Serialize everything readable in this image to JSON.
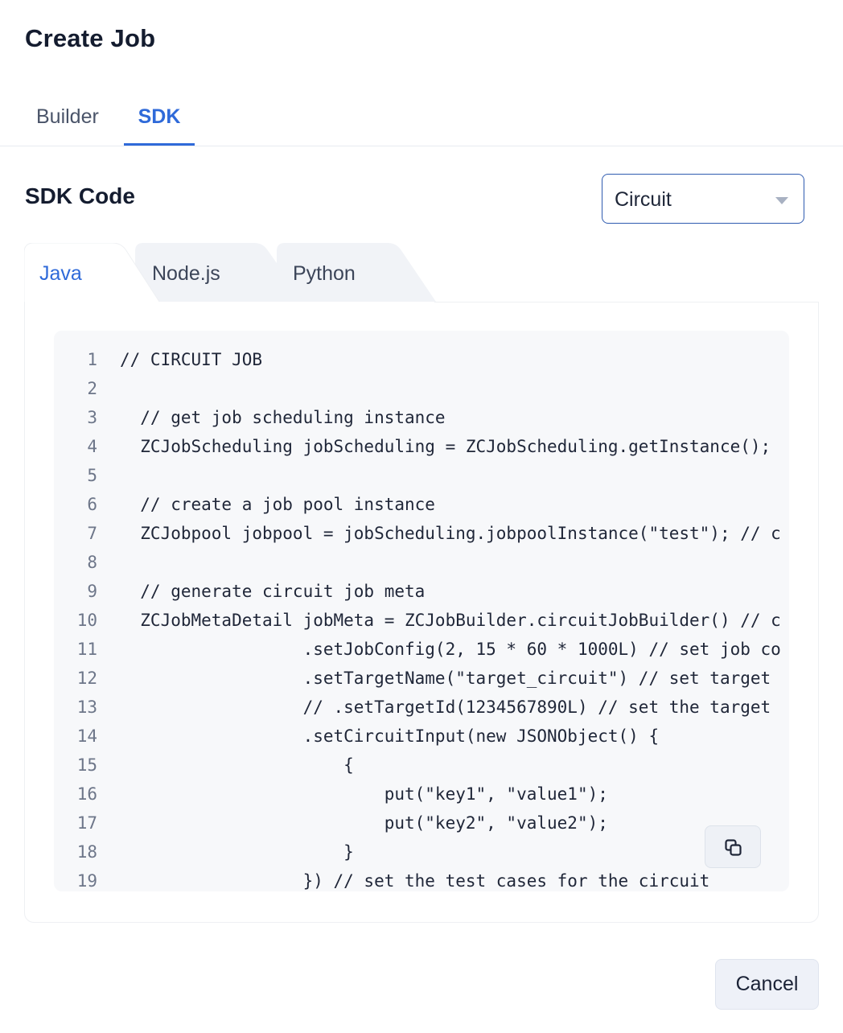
{
  "page": {
    "title": "Create Job"
  },
  "top_tabs": {
    "builder": "Builder",
    "sdk": "SDK"
  },
  "section": {
    "title": "SDK Code"
  },
  "job_type_select": {
    "value": "Circuit"
  },
  "lang_tabs": {
    "java": "Java",
    "node": "Node.js",
    "python": "Python"
  },
  "code": {
    "lines": [
      {
        "no": "1",
        "text": "// CIRCUIT JOB"
      },
      {
        "no": "2",
        "text": ""
      },
      {
        "no": "3",
        "text": "  // get job scheduling instance"
      },
      {
        "no": "4",
        "text": "  ZCJobScheduling jobScheduling = ZCJobScheduling.getInstance();"
      },
      {
        "no": "5",
        "text": ""
      },
      {
        "no": "6",
        "text": "  // create a job pool instance"
      },
      {
        "no": "7",
        "text": "  ZCJobpool jobpool = jobScheduling.jobpoolInstance(\"test\"); // c"
      },
      {
        "no": "8",
        "text": ""
      },
      {
        "no": "9",
        "text": "  // generate circuit job meta"
      },
      {
        "no": "10",
        "text": "  ZCJobMetaDetail jobMeta = ZCJobBuilder.circuitJobBuilder() // c"
      },
      {
        "no": "11",
        "text": "                  .setJobConfig(2, 15 * 60 * 1000L) // set job co"
      },
      {
        "no": "12",
        "text": "                  .setTargetName(\"target_circuit\") // set target"
      },
      {
        "no": "13",
        "text": "                  // .setTargetId(1234567890L) // set the target"
      },
      {
        "no": "14",
        "text": "                  .setCircuitInput(new JSONObject() {"
      },
      {
        "no": "15",
        "text": "                      {"
      },
      {
        "no": "16",
        "text": "                          put(\"key1\", \"value1\");"
      },
      {
        "no": "17",
        "text": "                          put(\"key2\", \"value2\");"
      },
      {
        "no": "18",
        "text": "                      }"
      },
      {
        "no": "19",
        "text": "                  }) // set the test cases for the circuit"
      }
    ]
  },
  "footer": {
    "cancel_label": "Cancel"
  },
  "icons": {
    "copy": "copy-icon",
    "caret": "caret-down-icon"
  },
  "colors": {
    "accent": "#2f6ad9",
    "code_bg": "#f7f8fa"
  }
}
